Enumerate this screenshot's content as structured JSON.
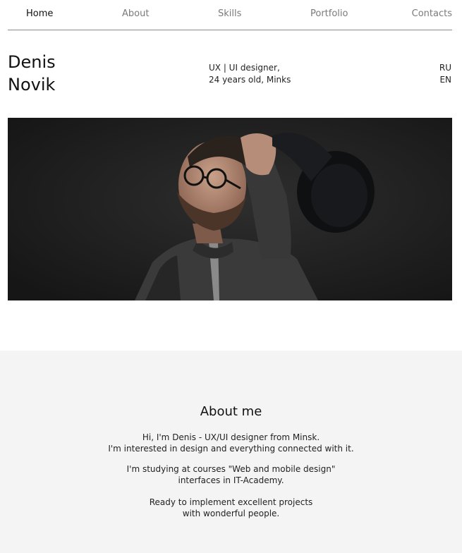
{
  "nav": {
    "items": [
      {
        "label": "Home"
      },
      {
        "label": "About"
      },
      {
        "label": "Skills"
      },
      {
        "label": "Portfolio"
      },
      {
        "label": "Contacts"
      }
    ],
    "active": "Home"
  },
  "header": {
    "first_name": "Denis",
    "last_name": "Novik",
    "role_line1": "UX | UI designer,",
    "role_line2": "24 years old, Minks",
    "lang_ru": "RU",
    "lang_en": "EN"
  },
  "about": {
    "title": "About me",
    "p1_line1": "Hi, I'm Denis - UX/UI designer from Minsk.",
    "p1_line2": "I'm interested in design and everything connected with it.",
    "p2_line1": "I'm studying at courses \"Web and mobile design\"",
    "p2_line2": "interfaces in IT-Academy.",
    "p3_line1": "Ready to implement excellent projects",
    "p3_line2": "with wonderful people."
  },
  "colors": {
    "nav_active": "#111111",
    "nav_inactive": "#7a7a7a",
    "about_bg": "#f4f4f4",
    "photo_bg": "#1e1e1e"
  }
}
